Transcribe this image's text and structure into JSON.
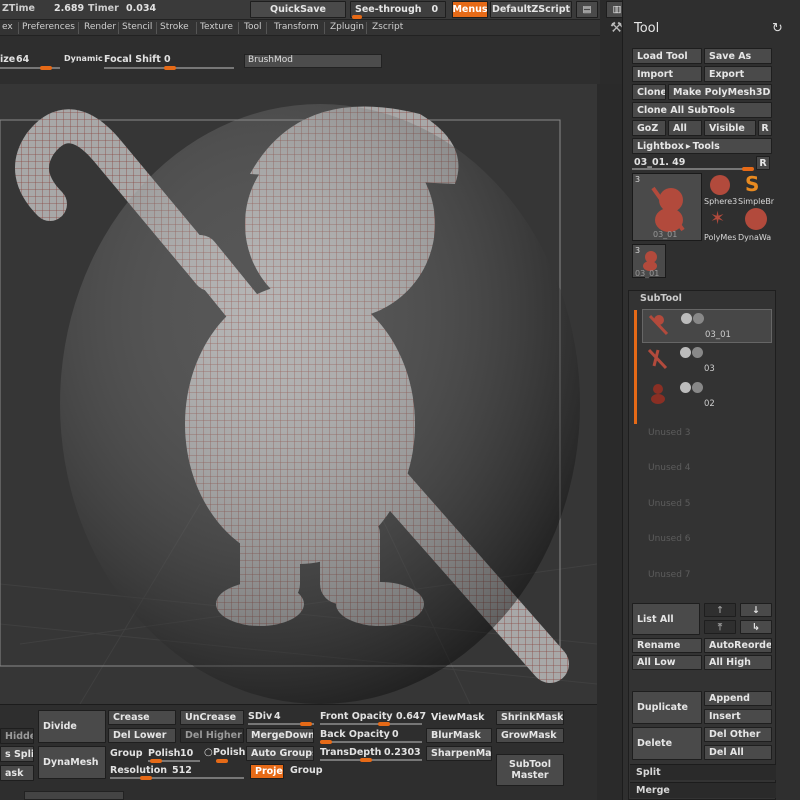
{
  "topbar": {
    "ztime_label": "ZTime",
    "ztime_value": "2.689",
    "timer_label": "Timer",
    "timer_value": "0.034",
    "quicksave": "QuickSave",
    "seethrough_label": "See-through",
    "seethrough_value": "0",
    "menus": "Menus",
    "script": "DefaultZScript"
  },
  "menubar": [
    "ex",
    "Preferences",
    "Render",
    "Stencil",
    "Stroke",
    "Texture",
    "Tool",
    "Transform",
    "Zplugin",
    "Zscript"
  ],
  "shelf": {
    "size_label": "ize",
    "size_value": "64",
    "dynamic": "Dynamic",
    "focal_label": "Focal Shift",
    "focal_value": "0",
    "brushmod": "BrushMod"
  },
  "tool_panel": {
    "title": "Tool",
    "load_tool": "Load Tool",
    "save_as": "Save As",
    "import": "Import",
    "export": "Export",
    "clone": "Clone",
    "make_polymesh": "Make PolyMesh3D",
    "clone_all": "Clone All SubTools",
    "goz": "GoZ",
    "all": "All",
    "visible": "Visible",
    "r": "R",
    "lightbox": "Lightbox",
    "tools": "Tools",
    "current_tool": "03_01. 49",
    "r2": "R",
    "thumb_count": "3",
    "thumb_name": "03_01",
    "items": [
      "Sphere3",
      "SimpleBr",
      "PolyMes",
      "DynaWa"
    ],
    "small_count": "3",
    "small_name": "03_01"
  },
  "subtool": {
    "title": "SubTool",
    "rows": [
      "03_01",
      "03",
      "02"
    ],
    "unused": [
      "Unused 3",
      "Unused 4",
      "Unused 5",
      "Unused 6",
      "Unused 7"
    ],
    "list_all": "List All",
    "rename": "Rename",
    "autoreorder": "AutoReorder",
    "all_low": "All Low",
    "all_high": "All High",
    "duplicate": "Duplicate",
    "append": "Append",
    "insert": "Insert",
    "delete": "Delete",
    "del_other": "Del Other",
    "del_all": "Del All",
    "split": "Split",
    "merge": "Merge"
  },
  "bottom": {
    "hidden": "Hidden",
    "divide": "Divide",
    "crease": "Crease",
    "uncrease": "UnCrease",
    "sdiv_label": "SDiv",
    "sdiv_value": "4",
    "front_opacity_label": "Front Opacity",
    "front_opacity_value": "0.647",
    "viewmask": "ViewMask",
    "shrinkmask": "ShrinkMask",
    "del_lower": "Del Lower",
    "del_higher": "Del Higher",
    "mergedown": "MergeDown",
    "back_opacity_label": "Back Opacity",
    "back_opacity_value": "0",
    "blurmask": "BlurMask",
    "growmask": "GrowMask",
    "s_split": "s Split",
    "dynamesh": "DynaMesh",
    "group": "Group",
    "polish_label": "Polish",
    "polish_value": "10",
    "polish_toggle": "Polish",
    "auto_groups": "Auto Groups",
    "transdepth_label": "TransDepth",
    "transdepth_value": "0.2303",
    "sharpenmask": "SharpenMask",
    "subtool_master_1": "SubTool",
    "subtool_master_2": "Master",
    "ask": "ask",
    "resolution_label": "Resolution",
    "resolution_value": "512",
    "project": "Proje",
    "group2": "Group"
  },
  "colors": {
    "accent": "#e66a17",
    "panel_bg": "#2f2f2f",
    "canvas_bg": "#363636",
    "model": "#a8584f"
  }
}
